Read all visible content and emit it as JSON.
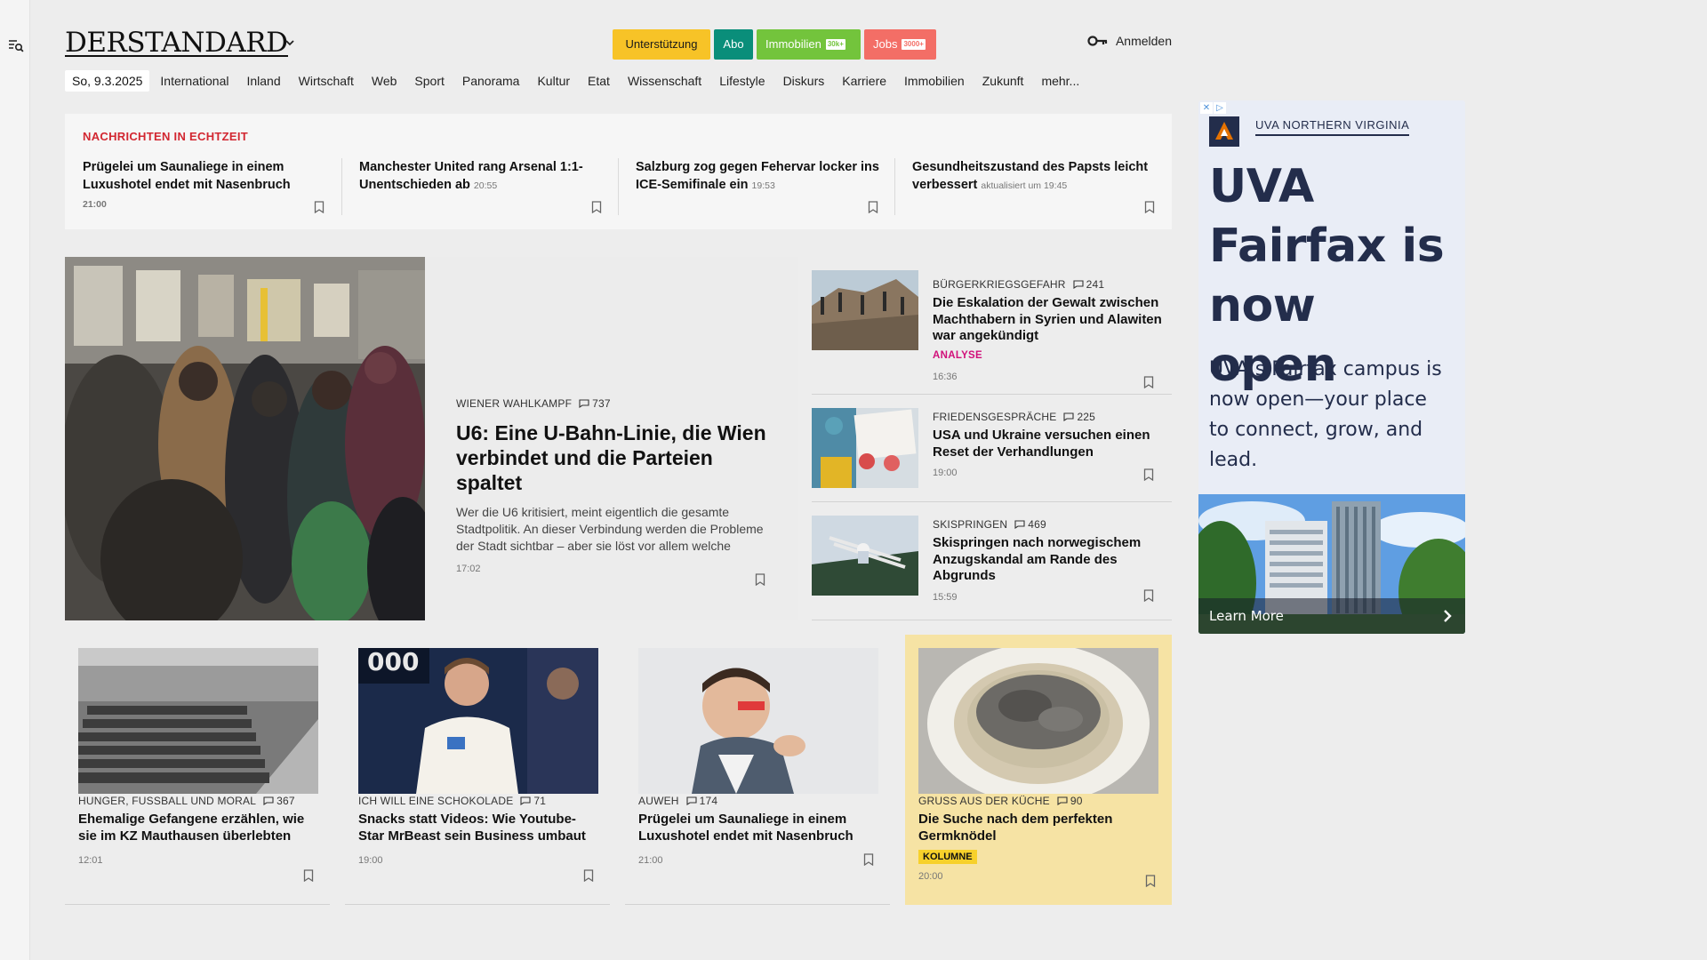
{
  "header": {
    "logo": "DERSTANDARD",
    "pills": {
      "support": "Unterstützung",
      "abo": "Abo",
      "immobilien": "Immobilien",
      "immobilien_tag": "30k+",
      "jobs": "Jobs",
      "jobs_tag": "3000+"
    },
    "login": "Anmelden"
  },
  "nav": {
    "date": "So, 9.3.2025",
    "items": [
      "International",
      "Inland",
      "Wirtschaft",
      "Web",
      "Sport",
      "Panorama",
      "Kultur",
      "Etat",
      "Wissenschaft",
      "Lifestyle",
      "Diskurs",
      "Karriere",
      "Immobilien",
      "Zukunft",
      "mehr..."
    ]
  },
  "ticker": {
    "heading": "NACHRICHTEN IN ECHTZEIT",
    "items": [
      {
        "title": "Prügelei um Saunaliege in einem Luxushotel endet mit Nasenbruch",
        "time": "21:00"
      },
      {
        "title": "Manchester United rang Arsenal 1:1-Unentschieden ab",
        "time": "20:55"
      },
      {
        "title": "Salzburg zog gegen Fehervar locker ins ICE-Semifinale ein",
        "time": "19:53"
      },
      {
        "title": "Gesundheitszustand des Papsts leicht verbessert",
        "time": "aktualisiert um 19:45"
      }
    ]
  },
  "lead": {
    "kicker": "WIENER WAHLKAMPF",
    "comments": "737",
    "title": "U6: Eine U-Bahn-Linie, die Wien verbindet und die Parteien spaltet",
    "teaser": "Wer die U6 kritisiert, meint eigentlich die gesamte Stadtpolitik. An dieser Verbindung werden die Probleme der Stadt sichtbar – aber sie löst vor allem welche",
    "time": "17:02"
  },
  "side": [
    {
      "kicker": "BÜRGERKRIEGSGEFAHR",
      "comments": "241",
      "title": "Die Eskalation der Gewalt zwischen Machthabern in Syrien und Alawiten war angekündigt",
      "label": "ANALYSE",
      "time": "16:36"
    },
    {
      "kicker": "FRIEDENSGESPRÄCHE",
      "comments": "225",
      "title": "USA und Ukraine versuchen einen Reset der Verhandlungen",
      "time": "19:00"
    },
    {
      "kicker": "SKISPRINGEN",
      "comments": "469",
      "title": "Skispringen nach norwegischem Anzugskandal am Rande des Abgrunds",
      "time": "15:59"
    }
  ],
  "cards": [
    {
      "kicker": "HUNGER, FUSSBALL UND MORAL",
      "comments": "367",
      "title": "Ehemalige Gefangene erzählen, wie sie im KZ Mauthausen überlebten",
      "time": "12:01"
    },
    {
      "kicker": "ICH WILL EINE SCHOKOLADE",
      "comments": "71",
      "title": "Snacks statt Videos: Wie Youtube-Star MrBeast sein Business umbaut",
      "time": "19:00"
    },
    {
      "kicker": "AUWEH",
      "comments": "174",
      "title": "Prügelei um Saunaliege in einem Luxushotel endet mit Nasenbruch",
      "time": "21:00"
    },
    {
      "kicker": "GRUSS AUS DER KÜCHE",
      "comments": "90",
      "title": "Die Suche nach dem perfekten Germknödel",
      "label": "KOLUMNE",
      "time": "20:00"
    }
  ],
  "ad": {
    "brand": "UVA NORTHERN VIRGINIA",
    "headline": "UVA Fairfax is now open",
    "subtext": "UVA’s Fairfax campus is now open—your place to connect, grow, and lead.",
    "cta": "Learn More"
  },
  "colors": {
    "breaking_red": "#d22731",
    "support": "#f7c327",
    "abo": "#0a8e7a",
    "immobilien": "#73c43c",
    "jobs": "#f36e66",
    "analyse": "#d1107a",
    "kolumne_bg": "#f6e3a4",
    "ad_navy": "#232d4b"
  }
}
